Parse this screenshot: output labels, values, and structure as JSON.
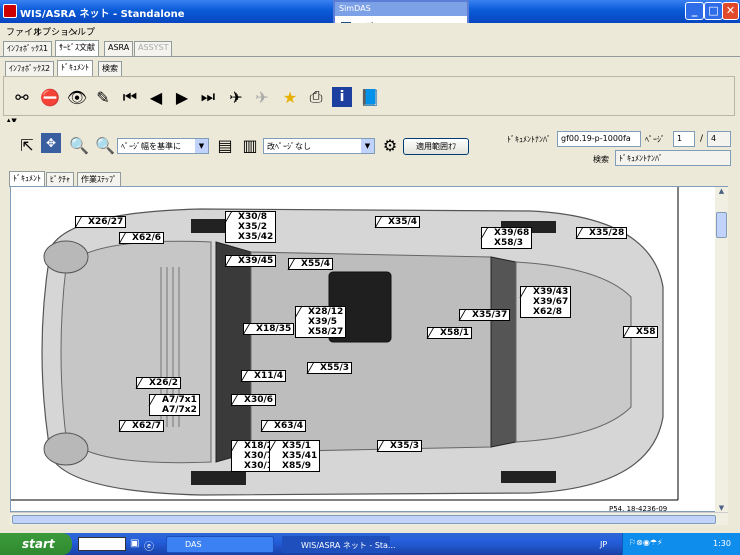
{
  "window": {
    "title": "WIS/ASRA ネット - Standalone",
    "min": "_",
    "max": "□",
    "close": "✕"
  },
  "menu": [
    "ファイル",
    "オプション",
    "ヘルプ"
  ],
  "tabs_main": [
    {
      "label": "ｲﾝﾌｫﾎﾞｯｸｽ1"
    },
    {
      "label": "ｻｰﾋﾞｽ文献"
    },
    {
      "label": "ASRA"
    },
    {
      "label": "ASSYST"
    }
  ],
  "tabs_sub": [
    {
      "label": "ｲﾝﾌｫﾎﾞｯｸｽ2"
    },
    {
      "label": "ﾄﾞｷｭﾒﾝﾄ"
    },
    {
      "label": "検索"
    }
  ],
  "popup": {
    "title": "SimDAS",
    "checkbox_label": "イグニッション ON",
    "checked": true
  },
  "viewer_bar": {
    "zoom_select": "ﾍﾟｰｼﾞ幅を基準に",
    "page_break_select": "改ﾍﾟｰｼﾞなし",
    "apply_button": "適用範囲ｵﾌ"
  },
  "document": {
    "number_label": "ﾄﾞｷｭﾒﾝﾄﾅﾝﾊﾞ",
    "number_value": "gf00.19-p-1000fa",
    "page_label": "ﾍﾟｰｼﾞ",
    "page_current": "1",
    "page_sep": "/",
    "page_total": "4",
    "search_label": "検索",
    "search_value": "ﾄﾞｷｭﾒﾝﾄﾅﾝﾊﾞ"
  },
  "tabs_view": [
    {
      "label": "ﾄﾞｷｭﾒﾝﾄ"
    },
    {
      "label": "ﾋﾟｸﾁｬ"
    },
    {
      "label": "作業ｽﾃｯﾌﾟ"
    }
  ],
  "diagram": {
    "ref": "P54. 18-4236-09",
    "labels": [
      "X26/27",
      "X62/6",
      "X30/8\nX35/2\nX35/42",
      "X35/4",
      "X39/68\nX58/3",
      "X35/28",
      "X39/45",
      "X55/4",
      "X28/12\nX39/5\nX58/27",
      "X18/35",
      "X35/37",
      "X39/43\nX39/67\nX62/8",
      "X58/1",
      "X58",
      "X55/3",
      "X11/4",
      "X26/2",
      "A7/7x1\nA7/7x2",
      "X30/6",
      "X63/4",
      "X62/7",
      "X18/28\nX30/7\nX30/12",
      "X35/1\nX35/41\nX85/9",
      "X35/3"
    ]
  },
  "taskbar": {
    "start": "start",
    "tasks": [
      "DAS",
      "WIS/ASRA ネット - Sta..."
    ],
    "lang": "JP",
    "clock": "1:30"
  }
}
